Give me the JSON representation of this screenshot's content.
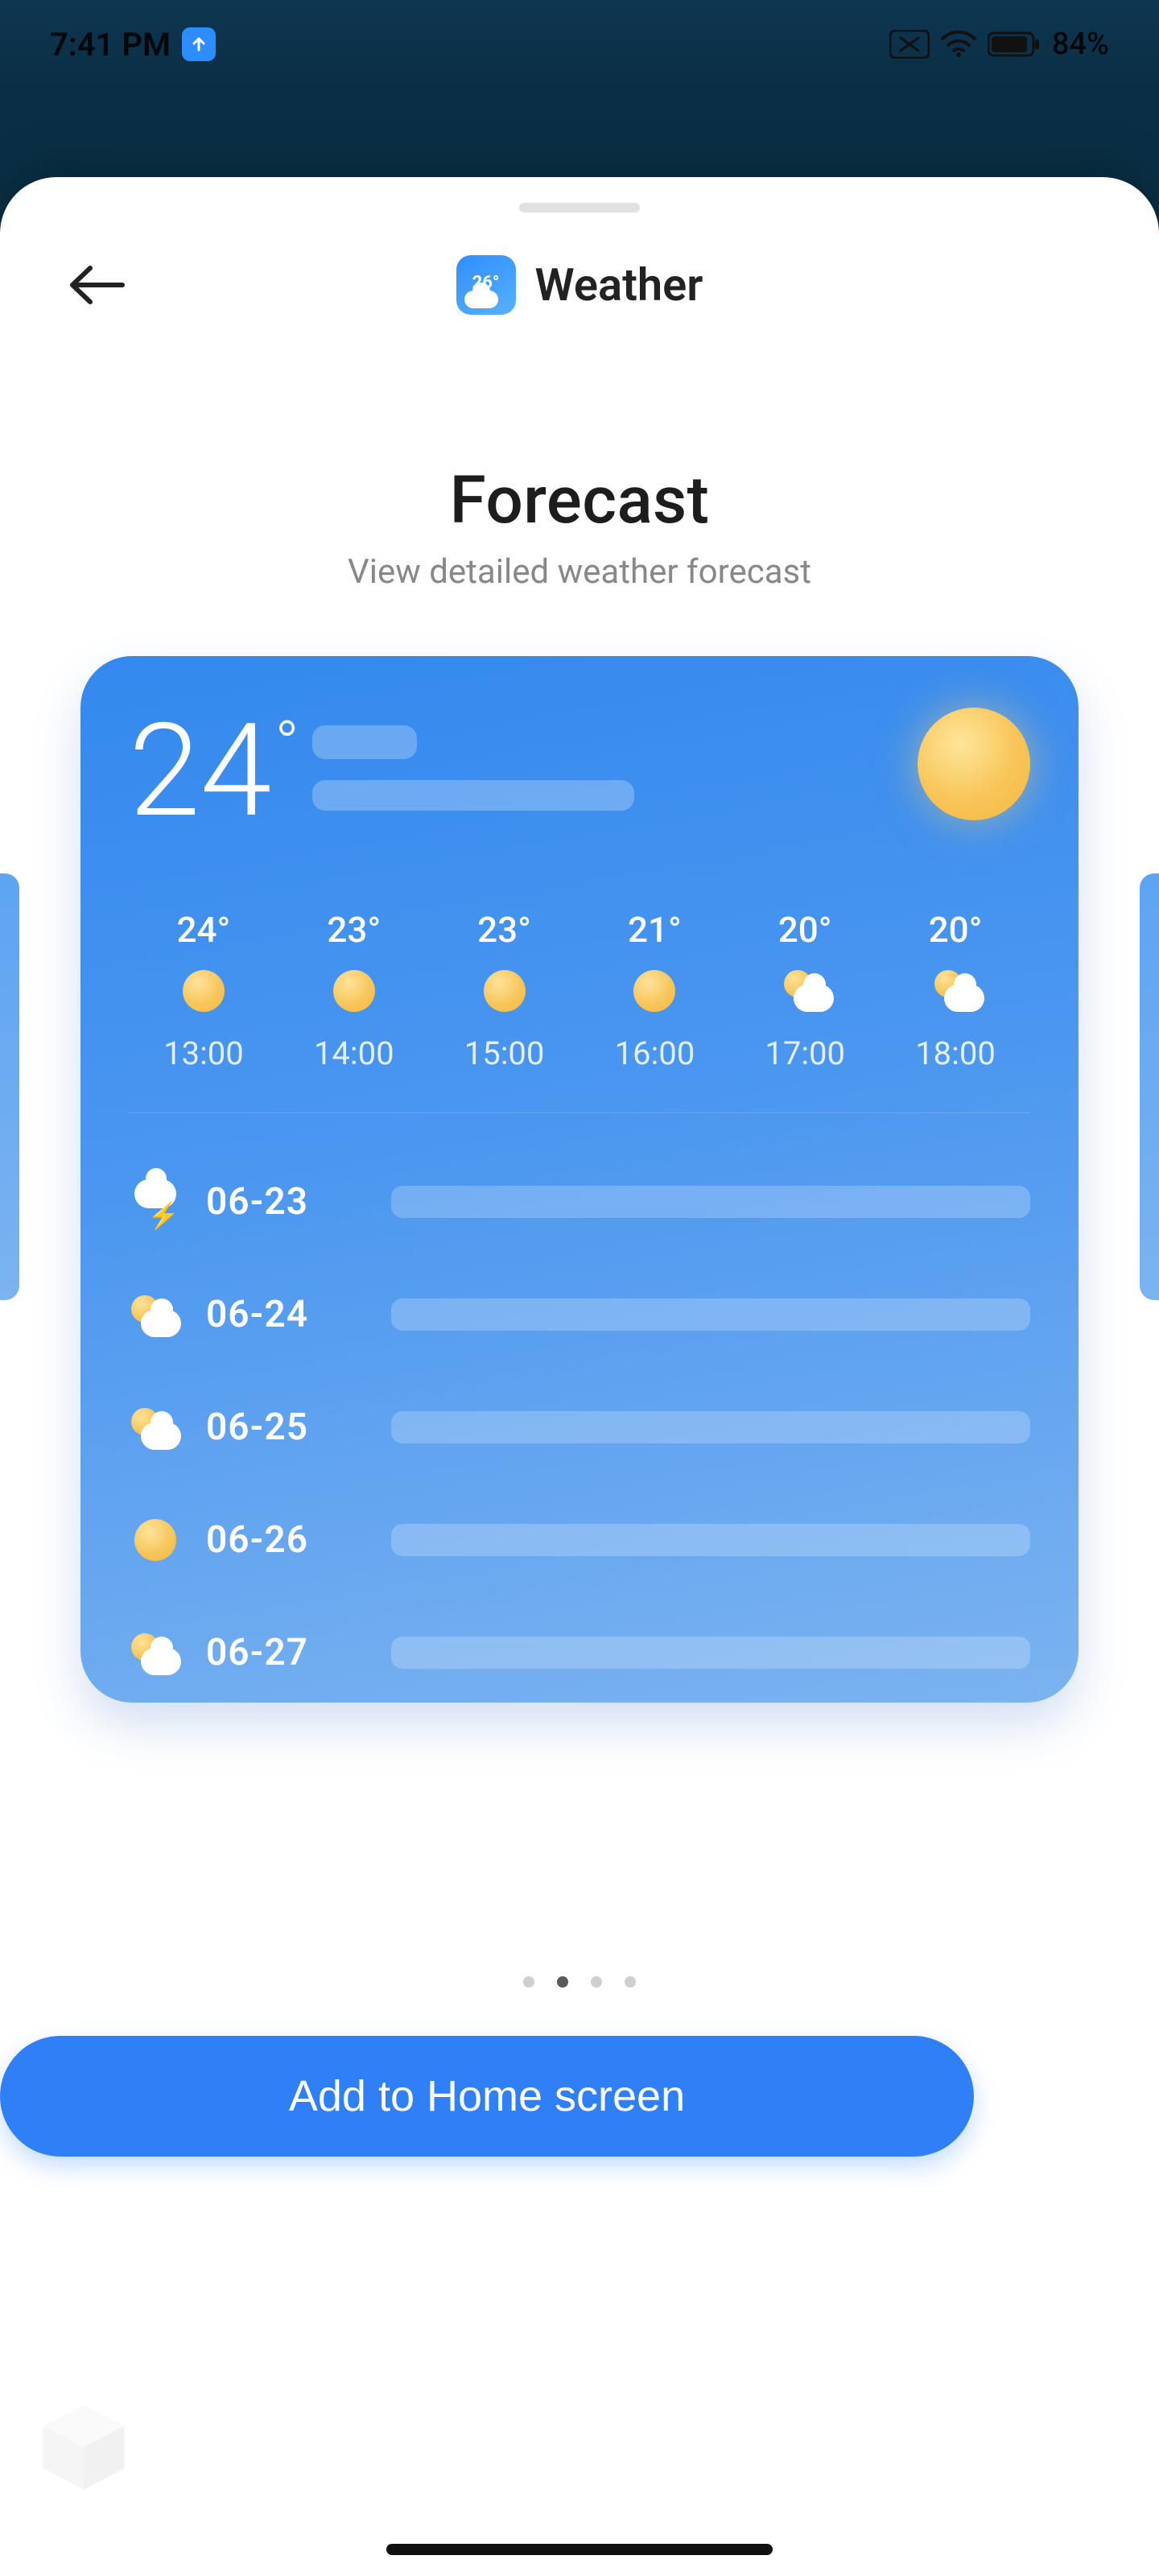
{
  "statusbar": {
    "time": "7:41 PM",
    "battery_percent": "84%"
  },
  "header": {
    "title": "Weather",
    "app_icon_text": "26°"
  },
  "hero": {
    "title": "Forecast",
    "subtitle": "View detailed weather forecast"
  },
  "widget": {
    "current_temp": "24",
    "degree": "°",
    "hourly": [
      {
        "temp": "24°",
        "time": "13:00",
        "icon": "sun"
      },
      {
        "temp": "23°",
        "time": "14:00",
        "icon": "sun"
      },
      {
        "temp": "23°",
        "time": "15:00",
        "icon": "sun"
      },
      {
        "temp": "21°",
        "time": "16:00",
        "icon": "sun"
      },
      {
        "temp": "20°",
        "time": "17:00",
        "icon": "partly"
      },
      {
        "temp": "20°",
        "time": "18:00",
        "icon": "partly"
      }
    ],
    "daily": [
      {
        "date": "06-23",
        "icon": "storm"
      },
      {
        "date": "06-24",
        "icon": "partly"
      },
      {
        "date": "06-25",
        "icon": "partly"
      },
      {
        "date": "06-26",
        "icon": "sun"
      },
      {
        "date": "06-27",
        "icon": "partly"
      }
    ]
  },
  "pager": {
    "count": 4,
    "active_index": 1
  },
  "cta": {
    "label": "Add to Home screen"
  }
}
